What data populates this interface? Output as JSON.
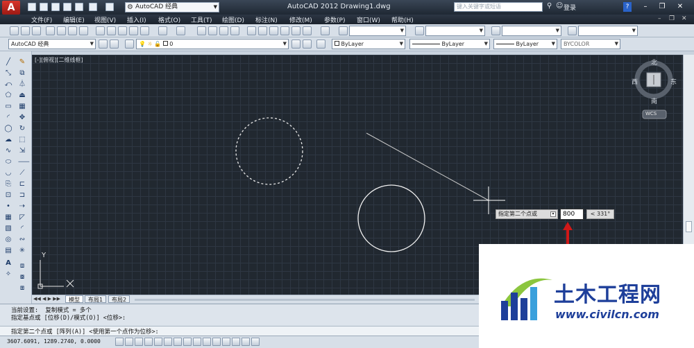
{
  "app": {
    "logo_letter": "A",
    "title": "AutoCAD 2012    Drawing1.dwg",
    "workspace": "AutoCAD 经典",
    "search_placeholder": "键入关键字或短语",
    "login": "登录"
  },
  "menu": [
    "文件(F)",
    "编辑(E)",
    "视图(V)",
    "插入(I)",
    "格式(O)",
    "工具(T)",
    "绘图(D)",
    "标注(N)",
    "修改(M)",
    "参数(P)",
    "窗口(W)",
    "帮助(H)"
  ],
  "toolbar2": {
    "workspace_combo": "AutoCAD 经典",
    "layer_combo": "0",
    "color_combo": "ByLayer",
    "linetype_combo": "ByLayer",
    "lineweight_combo": "ByLayer",
    "plotstyle_combo": "BYCOLOR"
  },
  "viewport": {
    "label": "[-][俯视][二维线框]"
  },
  "viewcube": {
    "north": "北",
    "south": "南",
    "east": "东",
    "west": "西",
    "ucs": "WCS"
  },
  "ucs_icon": {
    "x_label": "X",
    "y_label": "Y"
  },
  "tabs": [
    "模型",
    "布局1",
    "布局2"
  ],
  "dynamic_input": {
    "prompt": "指定第二个点或",
    "value": "800",
    "angle": "< 331°"
  },
  "command": {
    "line1": "当前设置:  复制模式 = 多个",
    "line2": "指定基点或 [位移(D)/模式(O)] <位移>:",
    "input": "指定第二个点或 [阵列(A)] <使用第一个点作为位移>:"
  },
  "status": {
    "coords": "3607.6091, 1289.2740, 0.0000"
  },
  "watermark": {
    "title": "土木工程网",
    "url": "www.civilcn.com"
  },
  "colors": {
    "canvas_bg": "#212830",
    "grid": "#2e3743",
    "arrow_red": "#d01818",
    "brand_blue": "#1e3f9a"
  }
}
